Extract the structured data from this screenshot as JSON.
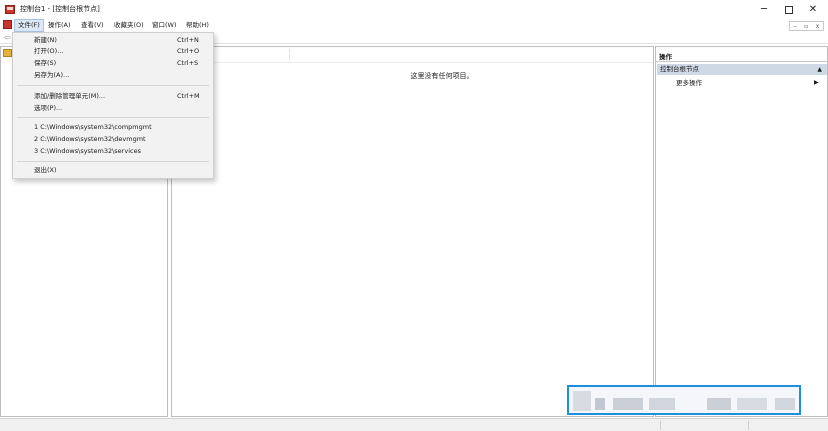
{
  "window": {
    "title": "控制台1 - [控制台根节点]",
    "min_glyph": "─",
    "close_glyph": "✕"
  },
  "menubar": {
    "items": [
      "文件(F)",
      "操作(A)",
      "查看(V)",
      "收藏夹(O)",
      "窗口(W)",
      "帮助(H)"
    ],
    "mdi_buttons": [
      "–",
      "▫",
      "x"
    ]
  },
  "toolbar": {
    "back_glyph": "⇦"
  },
  "file_menu": {
    "items": [
      {
        "label": "新建(N)",
        "shortcut": "Ctrl+N"
      },
      {
        "label": "打开(O)...",
        "shortcut": "Ctrl+O"
      },
      {
        "label": "保存(S)",
        "shortcut": "Ctrl+S"
      },
      {
        "label": "另存为(A)...",
        "shortcut": ""
      },
      {
        "label": "添加/删除管理单元(M)...",
        "shortcut": "Ctrl+M"
      },
      {
        "label": "选项(P)...",
        "shortcut": ""
      },
      {
        "label": "1 C:\\Windows\\system32\\compmgmt",
        "shortcut": ""
      },
      {
        "label": "2 C:\\Windows\\system32\\devmgmt",
        "shortcut": ""
      },
      {
        "label": "3 C:\\Windows\\system32\\services",
        "shortcut": ""
      },
      {
        "label": "退出(X)",
        "shortcut": ""
      }
    ]
  },
  "content": {
    "empty_message": "这里没有任何项目。"
  },
  "actions": {
    "title": "操作",
    "group_label": "控制台根节点",
    "group_caret": "▲",
    "more_label": "更多操作",
    "more_caret": "▶"
  },
  "colors": {
    "accent_border": "#1e8fe0",
    "group_header_bg": "#cfd8e5",
    "menu_bg": "#f2f2f2",
    "active_menu_bg": "#dce8f5"
  }
}
